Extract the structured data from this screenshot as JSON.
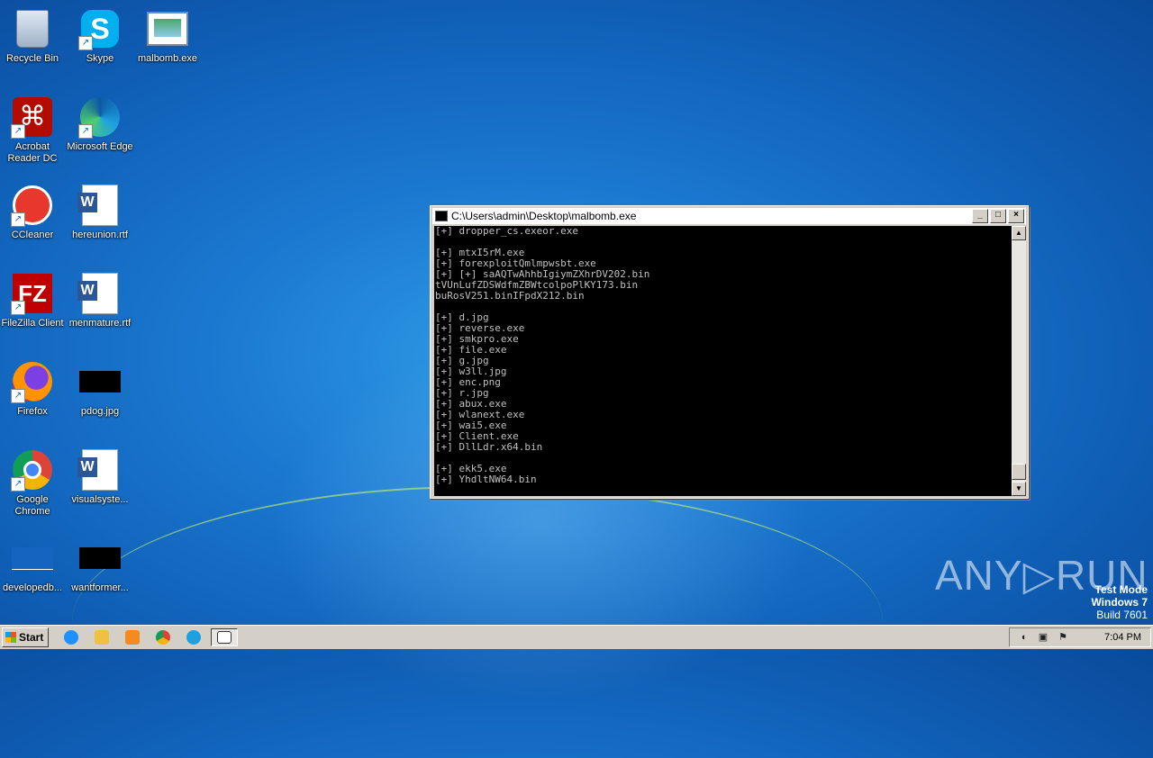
{
  "desktop": {
    "icons": [
      {
        "label": "Recycle Bin",
        "icon": "recycle-bin-icon"
      },
      {
        "label": "Skype",
        "icon": "skype-icon"
      },
      {
        "label": "malbomb.exe",
        "icon": "exe-file-icon"
      },
      {
        "label": "Acrobat Reader DC",
        "icon": "acrobat-icon"
      },
      {
        "label": "Microsoft Edge",
        "icon": "edge-icon"
      },
      {
        "label": "CCleaner",
        "icon": "ccleaner-icon"
      },
      {
        "label": "hereunion.rtf",
        "icon": "word-doc-icon"
      },
      {
        "label": "FileZilla Client",
        "icon": "filezilla-icon"
      },
      {
        "label": "menmature.rtf",
        "icon": "word-doc-icon"
      },
      {
        "label": "Firefox",
        "icon": "firefox-icon"
      },
      {
        "label": "pdog.jpg",
        "icon": "image-thumb-icon"
      },
      {
        "label": "Google Chrome",
        "icon": "chrome-icon"
      },
      {
        "label": "visualsyste...",
        "icon": "word-doc-icon"
      },
      {
        "label": "developedb...",
        "icon": "image-thumb-icon"
      },
      {
        "label": "wantformer...",
        "icon": "image-thumb-icon"
      }
    ]
  },
  "console": {
    "title": "C:\\Users\\admin\\Desktop\\malbomb.exe",
    "buttons": {
      "minimize": "_",
      "maximize": "□",
      "close": "×"
    },
    "lines": [
      "[+] dropper_cs.exeor.exe",
      "",
      "[+] mtxI5rM.exe",
      "[+] forexploitQmlmpwsbt.exe",
      "[+] [+] saAQTwAhhbIgiymZXhrDV202.bin",
      "tVUnLufZDSWdfmZBWtcolpoPlKY173.bin",
      "buRosV251.binIFpdX212.bin",
      "",
      "[+] d.jpg",
      "[+] reverse.exe",
      "[+] smkpro.exe",
      "[+] file.exe",
      "[+] g.jpg",
      "[+] w3ll.jpg",
      "[+] enc.png",
      "[+] r.jpg",
      "[+] abux.exe",
      "[+] wlanext.exe",
      "[+] wai5.exe",
      "[+] Client.exe",
      "[+] DllLdr.x64.bin",
      "",
      "[+] ekk5.exe",
      "[+] YhdltNW64.bin"
    ]
  },
  "watermark": {
    "brand": "ANY▷RUN",
    "test_mode": "Test Mode",
    "os": "Windows 7",
    "build": "Build 7601"
  },
  "taskbar": {
    "start_label": "Start",
    "clock": "7:04 PM"
  }
}
